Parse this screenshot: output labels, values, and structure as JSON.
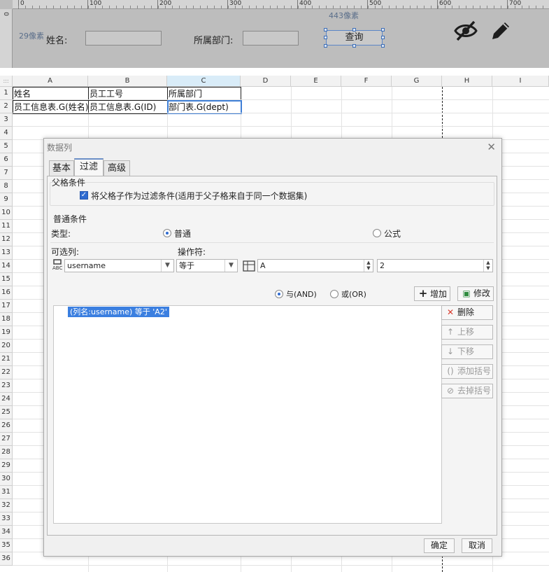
{
  "designer": {
    "ruler_labels": [
      "0",
      "100",
      "200",
      "300",
      "400",
      "500",
      "600",
      "700"
    ],
    "left_ruler_zero": "0",
    "height_label": "29像素",
    "width_label": "443像素",
    "name_label": "姓名:",
    "dept_label": "所属部门:",
    "name_input_value": "",
    "dept_input_value": "",
    "query_button": "查询",
    "tool_icons": [
      "eye-off-icon",
      "pencil-icon"
    ]
  },
  "sheet": {
    "corner": ":::",
    "columns": [
      "A",
      "B",
      "C",
      "D",
      "E",
      "F",
      "G",
      "H",
      "I"
    ],
    "selected_column": "C",
    "rows": [
      "1",
      "2",
      "3",
      "4",
      "5",
      "6",
      "7",
      "8",
      "9",
      "10",
      "11",
      "12",
      "13",
      "14",
      "15",
      "16",
      "17",
      "18",
      "19",
      "20",
      "21",
      "22",
      "23",
      "24",
      "25",
      "26",
      "27",
      "28",
      "29",
      "30",
      "31",
      "32",
      "33",
      "34",
      "35",
      "36"
    ],
    "cells": {
      "A1": "姓名",
      "B1": "员工工号",
      "C1": "所属部门",
      "A2": "员工信息表.G(姓名)",
      "B2": "员工信息表.G(ID)",
      "C2": "部门表.G(dept)"
    }
  },
  "dialog": {
    "title": "数据列",
    "close": "✕",
    "tabs": [
      "基本",
      "过滤",
      "高级"
    ],
    "active_tab": "过滤",
    "parent_group_title": "父格条件",
    "parent_checkbox_label": "将父格子作为过滤条件(适用于父子格来自于同一个数据集)",
    "parent_checkbox_checked": true,
    "common_group_title": "普通条件",
    "type_label": "类型:",
    "type_options": [
      "普通",
      "公式"
    ],
    "type_selected": "普通",
    "column_label": "可选列:",
    "column_value": "username",
    "operator_label": "操作符:",
    "operator_value": "等于",
    "value_type_icon": "grid-icon",
    "value_field": "A",
    "value_field2": "2",
    "logic_and": "与(AND)",
    "logic_or": "或(OR)",
    "logic_selected": "与(AND)",
    "add_button": "增加",
    "modify_button": "修改",
    "delete_button": "删除",
    "move_up_button": "上移",
    "move_down_button": "下移",
    "add_bracket_button": "添加括号",
    "remove_bracket_button": "去掉括号",
    "condition_items": [
      "(列名:username) 等于 'A2'"
    ],
    "ok_button": "确定",
    "cancel_button": "取消"
  }
}
